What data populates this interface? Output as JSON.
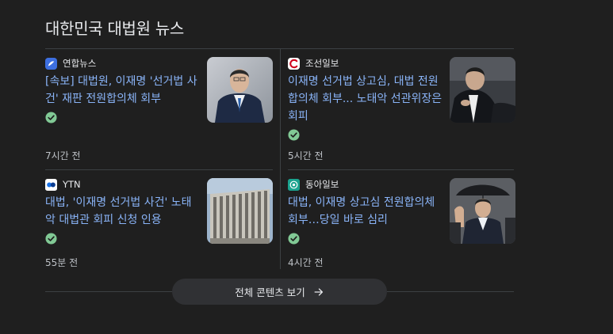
{
  "section": {
    "title": "대한민국 대법원 뉴스"
  },
  "articles": [
    {
      "publisher": "연합뉴스",
      "publisher_icon": "yonhap-logo-icon",
      "headline": "[속보] 대법원, 이재명 '선거법 사건' 재판 전원합의체 회부",
      "time": "7시간 전",
      "verified": true
    },
    {
      "publisher": "조선일보",
      "publisher_icon": "chosun-logo-icon",
      "headline": "이재명 선거법 상고심, 대법 전원합의체 회부... 노태악 선관위장은 회피",
      "time": "5시간 전",
      "verified": true
    },
    {
      "publisher": "YTN",
      "publisher_icon": "ytn-logo-icon",
      "headline": "대법, '이재명 선거법 사건' 노태악 대법관 회피 신청 인용",
      "time": "55분 전",
      "verified": true
    },
    {
      "publisher": "동아일보",
      "publisher_icon": "donga-logo-icon",
      "headline": "대법, 이재명 상고심 전원합의체 회부…당일 바로 심리",
      "time": "4시간 전",
      "verified": true
    }
  ],
  "more_button": {
    "label": "전체 콘텐츠 보기",
    "icon": "arrow-right-icon"
  },
  "colors": {
    "background": "#1f1f1f",
    "headline": "#8ab4f8",
    "verified": "#81c995",
    "divider": "#3c4043"
  }
}
